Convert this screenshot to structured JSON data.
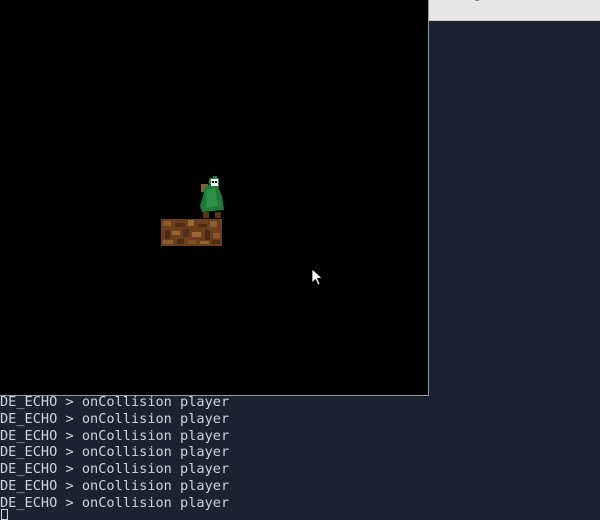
{
  "terminal": {
    "log_lines": [
      "DE_ECHO > onCollision player",
      "DE_ECHO > onCollision player",
      "DE_ECHO > onCollision player",
      "DE_ECHO > onCollision player",
      "DE_ECHO > onCollision player",
      "DE_ECHO > onCollision player",
      "DE_ECHO > onCollision player"
    ]
  },
  "game": {
    "background": "#000000",
    "platform_color": "#7a4b22",
    "player_cloak_color": "#1f7a3a",
    "icons": [
      "player-sprite",
      "dirt-platform",
      "mouse-pointer-icon"
    ]
  }
}
